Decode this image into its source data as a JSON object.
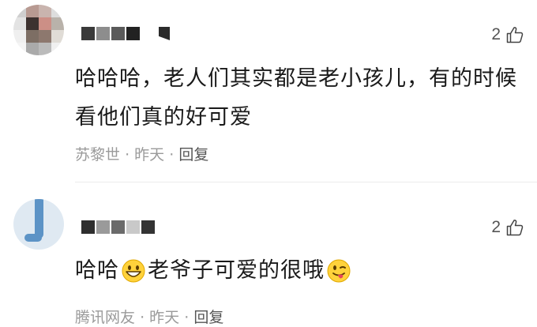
{
  "comments": [
    {
      "likes": "2",
      "text": "哈哈哈，老人们其实都是老小孩儿，有的时候看他们真的好可爱",
      "author": "苏黎世",
      "time": "昨天",
      "reply": "回复",
      "sep": "·"
    },
    {
      "likes": "2",
      "text_a": "哈哈",
      "text_b": "老爷子可爱的很哦",
      "author": "腾讯网友",
      "time": "昨天",
      "reply": "回复",
      "sep": "·"
    }
  ],
  "icons": {
    "like": "thumbs-up-icon",
    "emoji_smile": "grinning-face-emoji",
    "emoji_wink": "winking-tongue-emoji"
  }
}
